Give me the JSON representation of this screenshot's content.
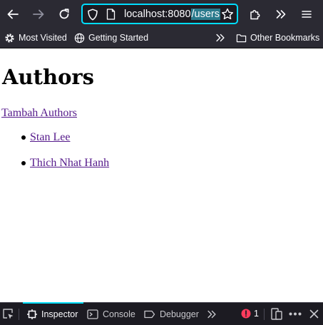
{
  "browser": {
    "url_host": "localhost:8080",
    "url_path": "/users",
    "accent_color": "#00ddff",
    "toolbar_icons": [
      "back-arrow-icon",
      "forward-arrow-icon",
      "reload-icon",
      "shield-icon",
      "page-icon",
      "star-icon",
      "extensions-icon",
      "overflow-chevrons-icon",
      "hamburger-menu-icon"
    ]
  },
  "bookmarks": {
    "most_visited": "Most Visited",
    "getting_started": "Getting Started",
    "other_bookmarks": "Other Bookmarks"
  },
  "page": {
    "title": "Authors",
    "add_link": "Tambah Authors",
    "authors": [
      "Stan Lee",
      "Thich Nhat Hanh"
    ],
    "link_color": "#551a8b"
  },
  "devtools": {
    "tabs": [
      "Inspector",
      "Console",
      "Debugger"
    ],
    "active_tab": "Inspector",
    "error_count": "1",
    "error_color": "#ff3b5c"
  }
}
